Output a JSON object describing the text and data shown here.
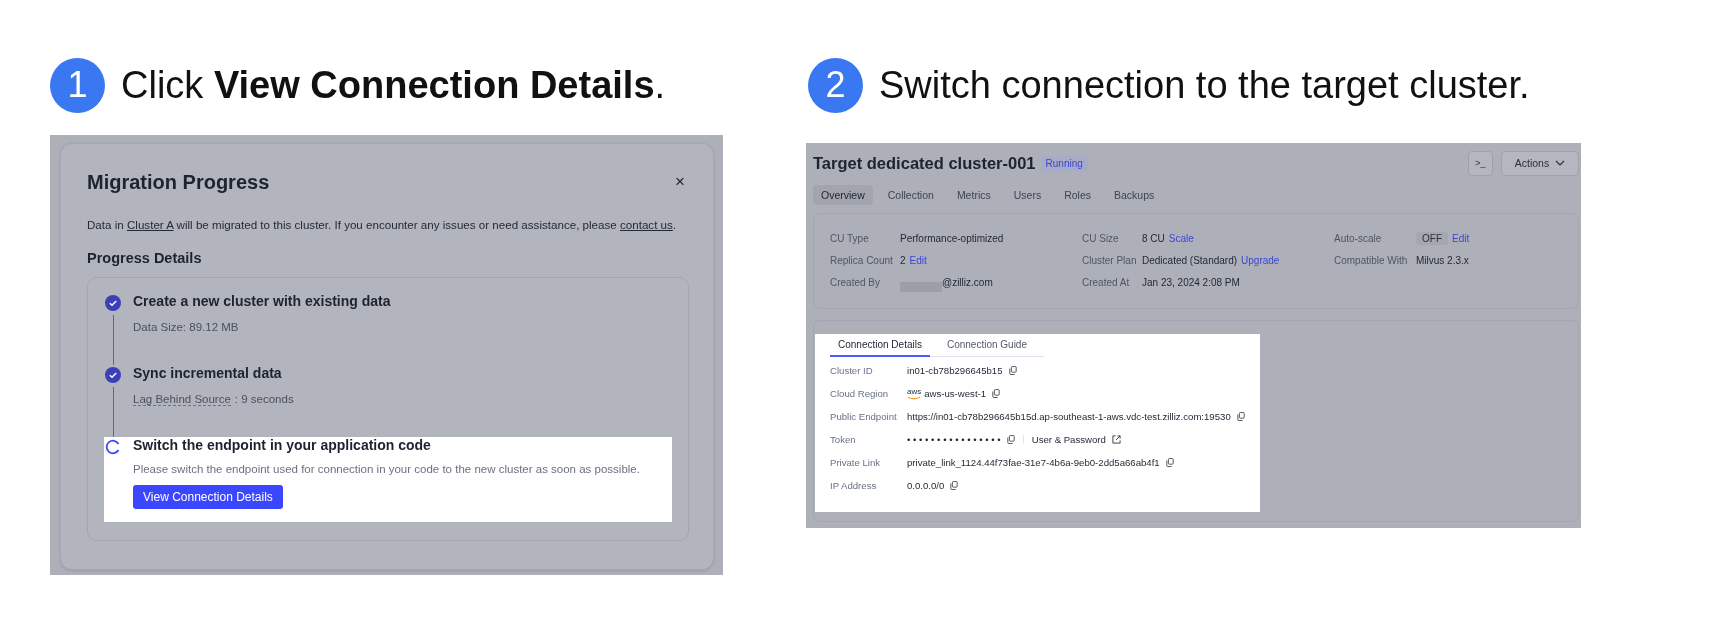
{
  "steps": [
    {
      "number": "1",
      "text": "Click **View Connection Details**."
    },
    {
      "number": "2",
      "text": "Switch connection to the target cluster."
    }
  ],
  "migration_dialog": {
    "title": "Migration Progress",
    "close": "×",
    "description": [
      {
        "kind": "text",
        "text": "Data in "
      },
      {
        "kind": "link",
        "text": "Cluster A"
      },
      {
        "kind": "text",
        "text": " will be migrated to this cluster. If you encounter any issues or need assistance, please "
      },
      {
        "kind": "link",
        "text": "contact us"
      },
      {
        "kind": "text",
        "text": "."
      }
    ],
    "progress_title": "Progress Details",
    "stages": [
      {
        "title": "Create a new cluster with existing data",
        "kind": "done",
        "highlighted": false,
        "detail": "Data Size: 89.12 MB"
      },
      {
        "title": "Sync incremental data",
        "kind": "done",
        "highlighted": false,
        "detail_term": "Lag Behind Source",
        "detail": ": 9 seconds"
      },
      {
        "title": "Switch the endpoint in your application code",
        "kind": "in_progress",
        "highlighted": true,
        "detail": "Please switch the endpoint used for connection in your code to the new cluster as soon as possible.",
        "button": "View Connection Details"
      }
    ]
  },
  "cluster_page": {
    "title": "Target dedicated cluster-001",
    "status": "Running",
    "terminal_button": ">_",
    "actions_button": "Actions",
    "tabs": [
      {
        "label": "Overview",
        "selected": true
      },
      {
        "label": "Collection",
        "selected": false
      },
      {
        "label": "Metrics",
        "selected": false
      },
      {
        "label": "Users",
        "selected": false
      },
      {
        "label": "Roles",
        "selected": false
      },
      {
        "label": "Backups",
        "selected": false
      }
    ],
    "info": [
      {
        "label": "CU Type",
        "value": "Performance-optimized"
      },
      {
        "label": "CU Size",
        "value": "8 CU",
        "link": "Scale"
      },
      {
        "label": "Auto-scale",
        "badge": "OFF",
        "link": "Edit"
      },
      {
        "label": "Replica Count",
        "value": "2",
        "link": "Edit"
      },
      {
        "label": "Cluster Plan",
        "value": "Dedicated (Standard)",
        "link": "Upgrade"
      },
      {
        "label": "Compatible With",
        "value": "Milvus 2.3.x"
      },
      {
        "label": "Created By",
        "redacted": true,
        "value": "@zilliz.com"
      },
      {
        "label": "Created At",
        "value": "Jan 23, 2024 2:08 PM"
      }
    ],
    "connection": {
      "highlighted": true,
      "tabs": [
        {
          "label": "Connection Details",
          "selected": true
        },
        {
          "label": "Connection Guide",
          "selected": false
        }
      ],
      "rows": [
        {
          "label": "Cluster ID",
          "value": "in01-cb78b296645b15"
        },
        {
          "label": "Cloud Region",
          "logo_text": "aws",
          "value": "aws-us-west-1"
        },
        {
          "label": "Public Endpoint",
          "value": "https://in01-cb78b296645b15d.ap-southeast-1-aws.vdc-test.zilliz.com:19530"
        },
        {
          "label": "Token",
          "value": "• • • • • • • • • • • • • • • •",
          "link": "User & Password"
        },
        {
          "label": "Private Link",
          "value": "private_link_1124.44f73fae-31e7-4b6a-9eb0-2dd5a66ab4f1"
        },
        {
          "label": "IP Address",
          "value": "0.0.0.0/0"
        }
      ]
    }
  }
}
